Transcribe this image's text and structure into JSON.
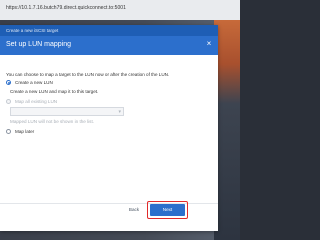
{
  "browser": {
    "url": "https://10.1.7.16.butch79.direct.quickconnect.to:5001"
  },
  "dialog": {
    "window_title": "Create a new iSCSI target",
    "heading": "Set up LUN mapping",
    "close_icon": "close-icon",
    "intro": "You can choose to map a target to the LUN now or after the creation of the LUN.",
    "options": [
      {
        "label": "Create a new LUN",
        "checked": true,
        "enabled": true
      },
      {
        "label": "Map all existing LUN",
        "checked": false,
        "enabled": false
      },
      {
        "label": "Map later",
        "checked": false,
        "enabled": true
      }
    ],
    "create_desc": "Create a new LUN and map it to this target.",
    "existing_select_placeholder": "",
    "existing_note": "Mapped LUN will not be shown in the list.",
    "buttons": {
      "back": "Back",
      "next": "Next"
    }
  },
  "colors": {
    "accent": "#2c6fcc",
    "highlight": "#e12a2a"
  }
}
